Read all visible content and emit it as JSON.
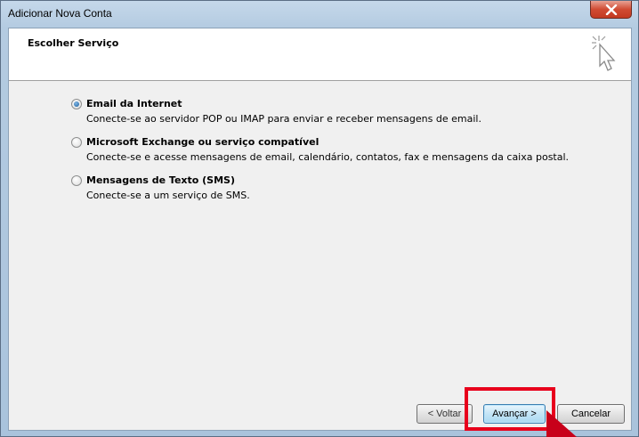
{
  "window": {
    "title": "Adicionar Nova Conta"
  },
  "header": {
    "title": "Escolher Serviço"
  },
  "options": [
    {
      "label": "Email da Internet",
      "description": "Conecte-se ao servidor POP ou IMAP para enviar e receber mensagens de email.",
      "selected": true
    },
    {
      "label": "Microsoft Exchange ou serviço compatível",
      "description": "Conecte-se e acesse mensagens de email, calendário, contatos, fax e mensagens da caixa postal.",
      "selected": false
    },
    {
      "label": "Mensagens de Texto (SMS)",
      "description": "Conecte-se a um serviço de SMS.",
      "selected": false
    }
  ],
  "buttons": {
    "back": "< Voltar",
    "next": "Avançar >",
    "cancel": "Cancelar"
  },
  "colors": {
    "highlight": "#e8001c",
    "close_button": "#c33a22"
  },
  "icons": {
    "close": "close-icon",
    "wizard": "cursor-click-icon"
  }
}
